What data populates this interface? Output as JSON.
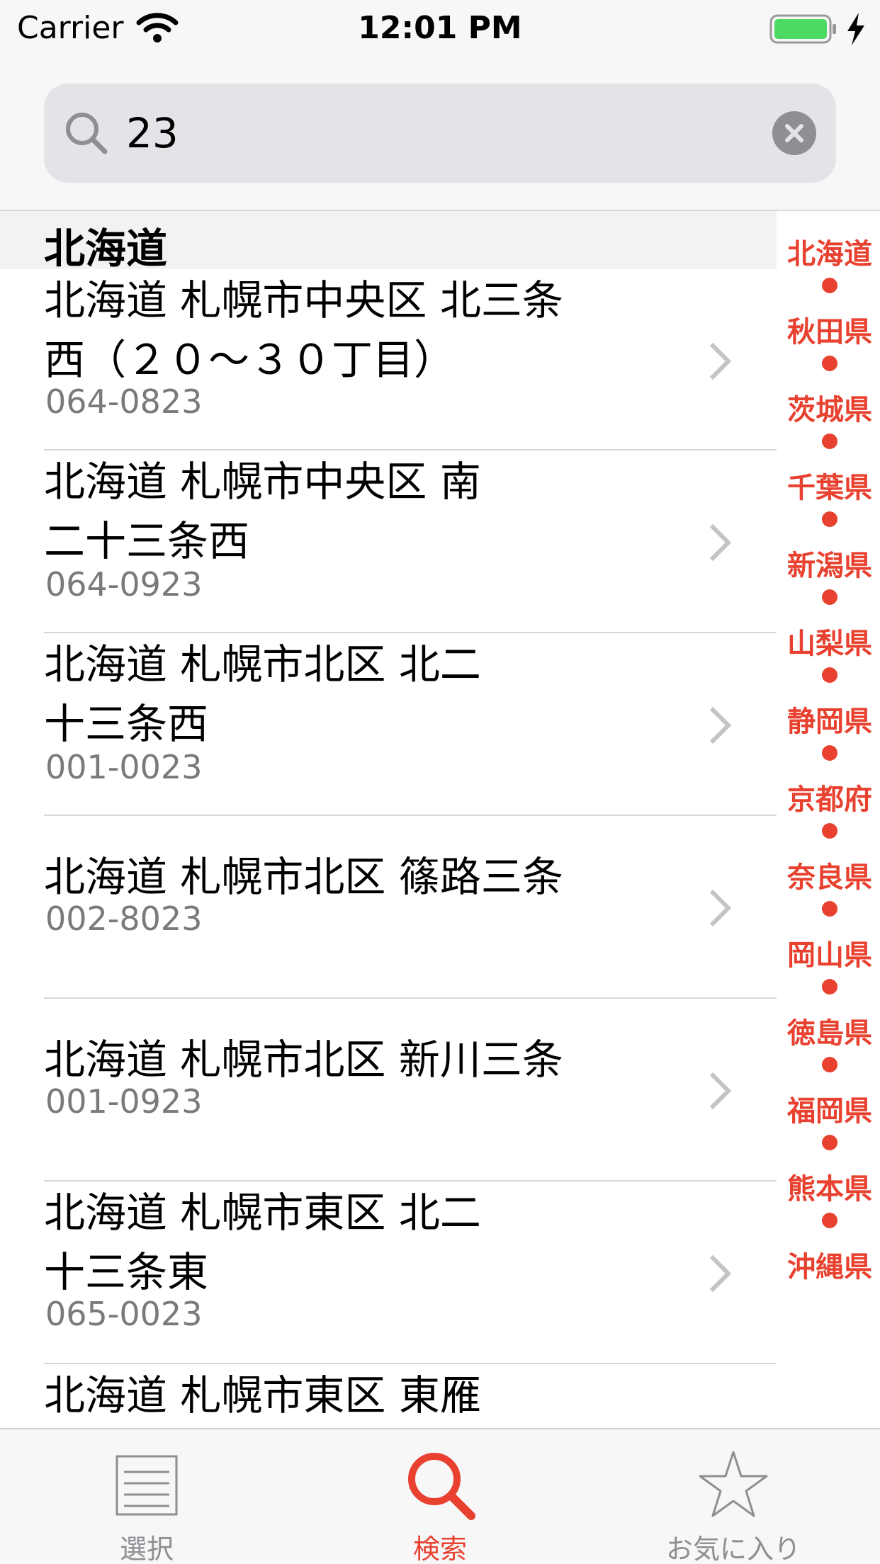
{
  "status_bar": {
    "carrier": "Carrier",
    "time": "12:01 PM"
  },
  "search": {
    "value": "23",
    "placeholder": ""
  },
  "section": {
    "title": "北海道"
  },
  "results": [
    {
      "address": "北海道 札幌市中央区 北三条\n西（２０～３０丁目）",
      "zip": "064-0823"
    },
    {
      "address": "北海道 札幌市中央区 南\n二十三条西",
      "zip": "064-0923"
    },
    {
      "address": "北海道 札幌市北区 北二\n十三条西",
      "zip": "001-0023"
    },
    {
      "address": "北海道 札幌市北区 篠路三条",
      "zip": "002-8023"
    },
    {
      "address": "北海道 札幌市北区 新川三条",
      "zip": "001-0923"
    },
    {
      "address": "北海道 札幌市東区 北二\n十三条東",
      "zip": "065-0023"
    },
    {
      "address": "北海道 札幌市東区 東雁",
      "zip": ""
    }
  ],
  "index": [
    "北海道",
    "秋田県",
    "茨城県",
    "千葉県",
    "新潟県",
    "山梨県",
    "静岡県",
    "京都府",
    "奈良県",
    "岡山県",
    "徳島県",
    "福岡県",
    "熊本県",
    "沖縄県"
  ],
  "tabs": [
    {
      "label": "選択",
      "icon": "list-icon",
      "active": false
    },
    {
      "label": "検索",
      "icon": "search-icon",
      "active": true
    },
    {
      "label": "お気に入り",
      "icon": "star-icon",
      "active": false
    }
  ],
  "colors": {
    "accent": "#e8412f",
    "secondary_text": "#7a7a7a",
    "battery": "#4cd964"
  }
}
